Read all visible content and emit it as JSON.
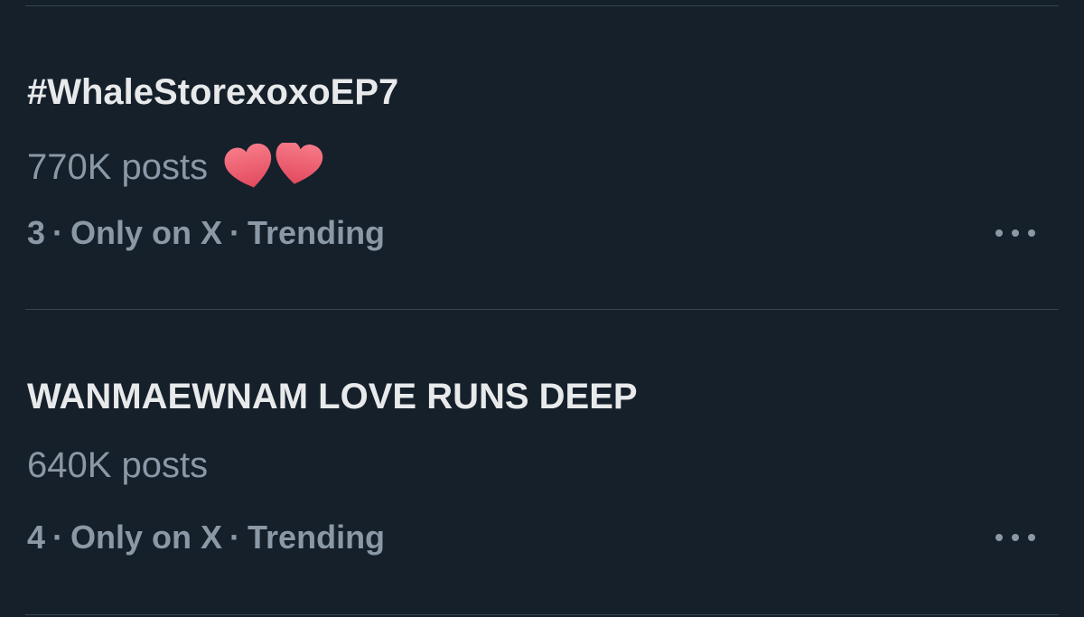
{
  "trends": [
    {
      "title": "#WhaleStorexoxoEP7",
      "posts": "770K posts",
      "rank": "3",
      "context": "Only on X",
      "status": "Trending",
      "emoji": "two-hearts"
    },
    {
      "title": "WANMAEWNAM LOVE RUNS DEEP",
      "posts": "640K posts",
      "rank": "4",
      "context": "Only on X",
      "status": "Trending"
    }
  ],
  "separator": "·",
  "colors": {
    "background": "#15202b",
    "title": "#e7e9ea",
    "secondary": "#8b98a5",
    "divider": "#38444d",
    "heart": "#f0596b"
  }
}
